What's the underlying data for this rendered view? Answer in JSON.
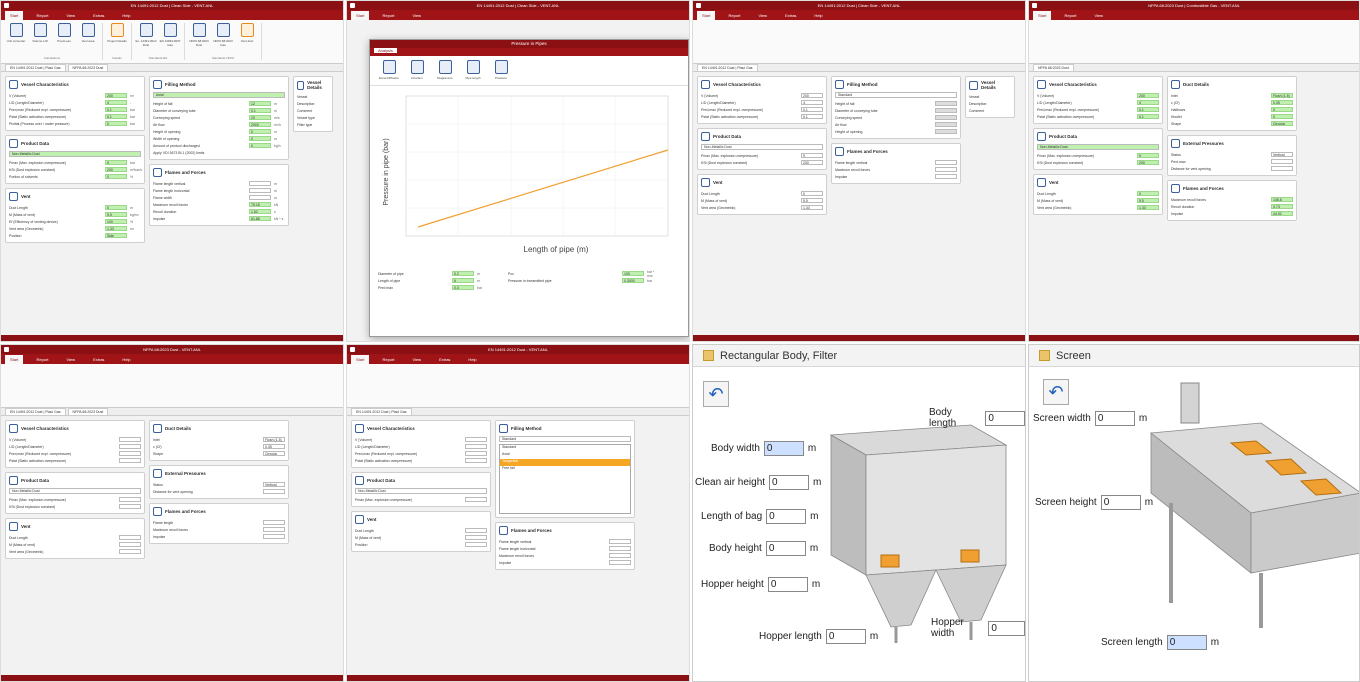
{
  "window1": {
    "title": "EN 14491:2012 Dust | Clean Side - VENT.ANL",
    "menu": [
      "Start",
      "Report",
      "View",
      "Extras",
      "Help"
    ],
    "ribbon": [
      "Unit converter",
      "Volume L/D",
      "Pred.Loss",
      "Vent area",
      "Project Details",
      "Ex. 14491:2012 Dust",
      "EN 14994:2007 Gas",
      "NFPA 68:2023 Dust",
      "NFPA 68:2023 Gas",
      "Vent duct"
    ],
    "ribbon_groups": [
      "Calculations",
      "Details",
      "Standards EN",
      "Standards NFPA"
    ],
    "tabs": [
      "EN 14491:2012 Dust | Plaul Gas",
      "NFPA 68:2023 Dust"
    ],
    "vessel_title": "Vessel Characteristics",
    "vessel_rows": [
      {
        "label": "V (Volume)",
        "value": "200",
        "unit": "m³"
      },
      {
        "label": "L/D (Length/Diameter)",
        "value": "4",
        "unit": "-"
      },
      {
        "label": "Pred,max (Reduced expl. overpressure)",
        "value": "0.1",
        "unit": "bar"
      },
      {
        "label": "Pstat (Static activation overpressure)",
        "value": "0.1",
        "unit": "bar"
      },
      {
        "label": "Pinitial (Process over / under pressure)",
        "value": "0",
        "unit": "bar"
      }
    ],
    "product_title": "Product Data",
    "product_select": "Non-Metallic Dust",
    "product_rows": [
      {
        "label": "Pmax (Max. explosion overpressure)",
        "value": "9",
        "unit": "bar"
      },
      {
        "label": "KSt (Dust explosion constant)",
        "value": "200",
        "unit": "m*bar/s"
      },
      {
        "label": "Portion of solvents",
        "value": "0",
        "unit": "%"
      }
    ],
    "vent_title": "Vent",
    "vent_rows": [
      {
        "label": "Duct Length",
        "value": "0",
        "unit": "m"
      },
      {
        "label": "M (Mass of vent)",
        "value": "5.5",
        "unit": "kg/m²"
      },
      {
        "label": "Ef (Efficiency of venting device)",
        "value": "100",
        "unit": "%"
      },
      {
        "label": "Vent area (Geometric)",
        "value": "1.33",
        "unit": "m²"
      },
      {
        "label": "Position",
        "value": "Side",
        "unit": ""
      }
    ],
    "filling_title": "Filling Method",
    "filling_select": "Axial",
    "filling_rows": [
      {
        "label": "Height of fall",
        "value": "12",
        "unit": "m"
      },
      {
        "label": "Diameter of conveying tube",
        "value": "0.1",
        "unit": "m"
      },
      {
        "label": "Conveying speed",
        "value": "20",
        "unit": "m/s"
      },
      {
        "label": "Air flow",
        "value": "2000",
        "unit": "m³/h"
      },
      {
        "label": "Height of opening",
        "value": "0",
        "unit": "m"
      },
      {
        "label": "Width of opening",
        "value": "0",
        "unit": "m"
      },
      {
        "label": "Amount of product discharged",
        "value": "0",
        "unit": "kg/h"
      }
    ],
    "filling_check": "Apply VDI 3673 Bl.1 (2002) limits",
    "flames_title": "Flames and Forces",
    "flames_rows": [
      {
        "label": "Flame length vertical",
        "value": "",
        "unit": "m"
      },
      {
        "label": "Flame length horizontal",
        "value": "",
        "unit": "m"
      },
      {
        "label": "Flame width",
        "value": "",
        "unit": "m"
      },
      {
        "label": "Maximum recoil forces",
        "value": "75.18",
        "unit": "kN"
      },
      {
        "label": "Recoil duration",
        "value": "1.62",
        "unit": "s"
      },
      {
        "label": "Impulse",
        "value": "61.88",
        "unit": "kN * s"
      }
    ],
    "side_title": "Vessel Details",
    "side_rows": [
      "Vessel",
      "Description",
      "Comment",
      "Vessel type",
      "Filter type"
    ]
  },
  "window2": {
    "title": "EN 14491:2012 Dust | Clean Side - VENT.ANL",
    "dialog_title": "Pressure in Pipes",
    "dialog_tab": "Analysis",
    "dialog_buttons": [
      "Excel-Diffusion",
      "Drucken",
      "Diagramme",
      "Pipe length",
      "Pressure"
    ],
    "chart_xlabel": "Length of pipe (m)",
    "chart_ylabel": "Pressure in pipe (bar)",
    "params": [
      {
        "label": "Diameter of pipe",
        "value": "0.2",
        "unit": "m"
      },
      {
        "label": "Length of pipe",
        "value": "6",
        "unit": "m"
      },
      {
        "label": "Pred max",
        "value": "0.3",
        "unit": "bar"
      },
      {
        "label": "Pcc",
        "value": "100",
        "unit": "bar * m/s"
      },
      {
        "label": "Pressure in transmitted pipe",
        "value": "0.3000",
        "unit": "bar"
      }
    ]
  },
  "window3": {
    "title": "EN 14491:2012 Dust | Clean Side - VENT.ANL",
    "filling_select": "Standard",
    "side_title": "Vessel Details"
  },
  "window4": {
    "title": "NFPA 68:2023 Dust | Combustible Gas - VENT.ANL",
    "duct_title": "Duct Details",
    "duct_rows": [
      {
        "label": "Inlet",
        "value": "Flush (1.5)",
        "unit": ""
      },
      {
        "label": "c (Cf)",
        "value": "0.35",
        "unit": ""
      },
      {
        "label": "Hallbows",
        "value": "0",
        "unit": ""
      },
      {
        "label": "Kbullet",
        "value": "0",
        "unit": ""
      },
      {
        "label": "Dh",
        "value": "0",
        "unit": "m"
      },
      {
        "label": "Shape",
        "value": "Circular",
        "unit": ""
      }
    ],
    "ext_title": "External Pressures",
    "ext_rows": [
      {
        "label": "Status",
        "value": "Vertical",
        "unit": ""
      },
      {
        "label": "Pext,max",
        "value": "",
        "unit": "bar"
      },
      {
        "label": "Distance for vent opening",
        "value": "",
        "unit": "m"
      }
    ],
    "flames_rows": [
      {
        "label": "Flame length",
        "value": "",
        "unit": "m"
      },
      {
        "label": "Flame width",
        "value": "",
        "unit": "m"
      },
      {
        "label": "Maximum recoil forces",
        "value": "108.8",
        "unit": "kN"
      },
      {
        "label": "Recoil duration",
        "value": "0.73",
        "unit": "s"
      },
      {
        "label": "Impulse",
        "value": "44.92",
        "unit": "kN * s"
      }
    ]
  },
  "window5": {
    "title": "NFPA 68:2023 Dust - VENT.ANL"
  },
  "window6": {
    "title": "EN 14491:2012 Dust - VENT.ANL",
    "filling_options": [
      "Standard",
      "Axial",
      "Tangential",
      "Free fall"
    ],
    "filling_selected": "Tangential"
  },
  "filter_pane": {
    "title": "Rectangular Body, Filter",
    "fields": [
      {
        "label": "Body length",
        "value": "0",
        "unit": ""
      },
      {
        "label": "Body width",
        "value": "0",
        "unit": "m"
      },
      {
        "label": "Clean air height",
        "value": "0",
        "unit": "m"
      },
      {
        "label": "Length of bag",
        "value": "0",
        "unit": "m"
      },
      {
        "label": "Body height",
        "value": "0",
        "unit": "m"
      },
      {
        "label": "Hopper height",
        "value": "0",
        "unit": "m"
      },
      {
        "label": "Hopper length",
        "value": "0",
        "unit": "m"
      },
      {
        "label": "Hopper width",
        "value": "0",
        "unit": ""
      }
    ]
  },
  "screen_pane": {
    "title": "Screen",
    "fields": [
      {
        "label": "Screen width",
        "value": "0",
        "unit": "m"
      },
      {
        "label": "Screen height",
        "value": "0",
        "unit": "m"
      },
      {
        "label": "Screen length",
        "value": "0",
        "unit": "m"
      }
    ]
  },
  "colors": {
    "brand": "#8b1014",
    "accent_green": "#bff0b0",
    "chart_line": "#f0a030",
    "highlight": "#f5a623"
  }
}
